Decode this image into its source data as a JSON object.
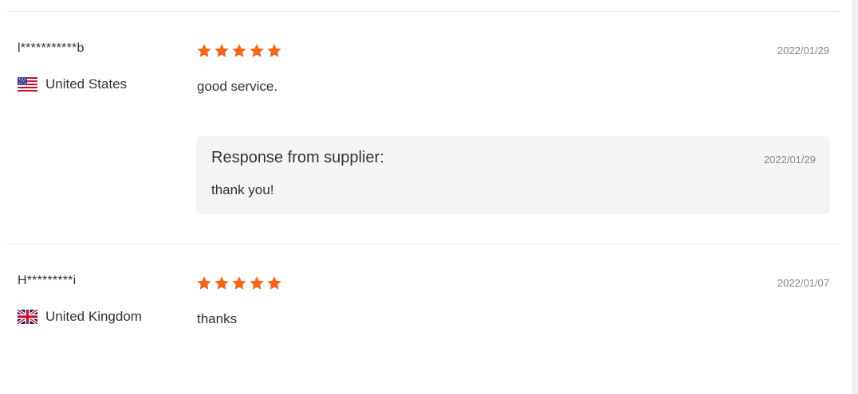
{
  "colors": {
    "star": "#f6661a",
    "text": "#333333",
    "muted": "#888888",
    "response_bg": "#f4f4f4"
  },
  "reviews": [
    {
      "buyer": "l***********b",
      "country": "United States",
      "flag_icon": "us-flag-icon",
      "rating": 5,
      "date": "2022/01/29",
      "comment": "good service.",
      "response": {
        "title": "Response from supplier:",
        "date": "2022/01/29",
        "text": "thank you!"
      }
    },
    {
      "buyer": "H*********i",
      "country": "United Kingdom",
      "flag_icon": "uk-flag-icon",
      "rating": 5,
      "date": "2022/01/07",
      "comment": "thanks"
    }
  ]
}
